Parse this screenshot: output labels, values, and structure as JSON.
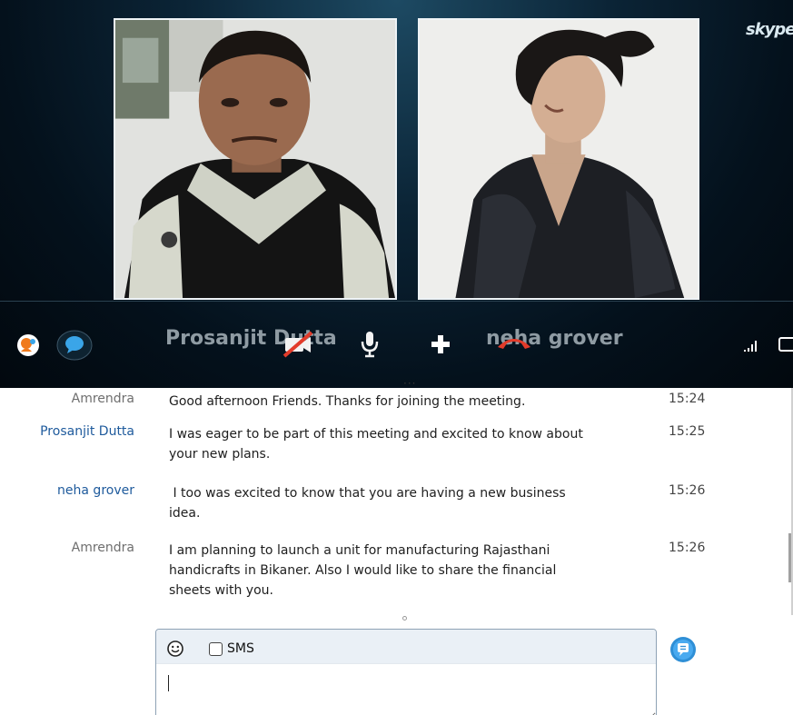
{
  "brand": "skype",
  "call": {
    "participants": [
      {
        "name": "Prosanjit Dutta"
      },
      {
        "name": "neha grover"
      }
    ],
    "signal_label": "..ıll"
  },
  "icons": {
    "contacts": "contacts-icon",
    "chat": "chat-bubble-icon",
    "video_off": "video-off-icon",
    "microphone": "microphone-icon",
    "add": "add-icon",
    "hang_up": "hang-up-icon",
    "signal": "signal-strength-icon",
    "fullscreen": "fullscreen-icon",
    "emoticon": "emoticon-icon",
    "send": "send-icon"
  },
  "colors": {
    "hang_up": "#e23b2a",
    "contacts": "#f07a1c",
    "chat": "#3aa5e8",
    "sender_blue": "#1e5a9c"
  },
  "chat": {
    "messages": [
      {
        "sender": "Amrendra",
        "text": "Good afternoon Friends. Thanks for joining the meeting.",
        "time": "15:24"
      },
      {
        "sender": "Prosanjit Dutta",
        "text": "I was eager to be part of this meeting and excited to know about\nyour new plans.",
        "time": "15:25"
      },
      {
        "sender": "neha grover",
        "text": " I too was excited to know that you are having a new business\nidea.",
        "time": "15:26"
      },
      {
        "sender": "Amrendra",
        "text": "I am planning to launch a unit for manufacturing Rajasthani\nhandicrafts in Bikaner. Also I would like to share the financial\nsheets with you.",
        "time": "15:26"
      }
    ]
  },
  "composer": {
    "sms_label": "SMS",
    "sms_checked": false,
    "value": ""
  }
}
